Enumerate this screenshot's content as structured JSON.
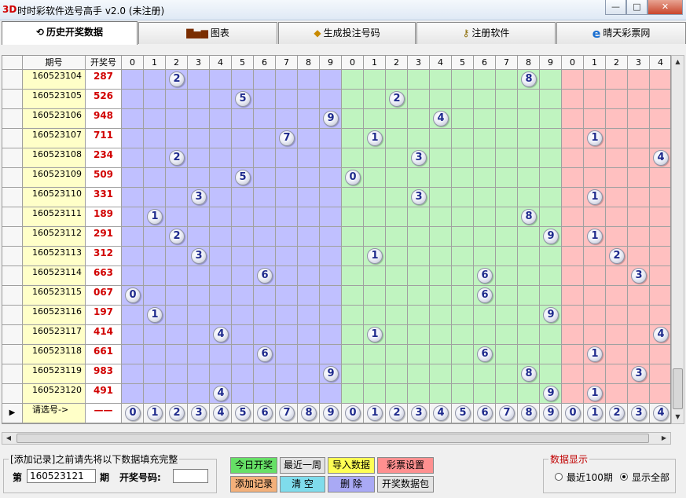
{
  "window": {
    "logo": "3D",
    "title": "时时彩软件选号高手 v2.0 (未注册)",
    "minimize": "—",
    "maximize": "□",
    "close": "✕"
  },
  "tabs": [
    {
      "label": "历史开奖数据",
      "icon": "history-icon",
      "active": true
    },
    {
      "label": "图表",
      "icon": "chart-icon",
      "active": false
    },
    {
      "label": "生成投注号码",
      "icon": "generate-icon",
      "active": false
    },
    {
      "label": "注册软件",
      "icon": "key-icon",
      "active": false
    },
    {
      "label": "晴天彩票网",
      "icon": "ie-browser-icon",
      "active": false
    }
  ],
  "grid": {
    "headers": {
      "period": "期号",
      "number": "开奖号"
    },
    "digit_headers": [
      "0",
      "1",
      "2",
      "3",
      "4",
      "5",
      "6",
      "7",
      "8",
      "9",
      "0",
      "1",
      "2",
      "3",
      "4",
      "5",
      "6",
      "7",
      "8",
      "9",
      "0",
      "1",
      "2",
      "3",
      "4"
    ],
    "zone_colors": [
      "#c0c0ff",
      "#c0f4c0",
      "#ffc0c0"
    ],
    "rows": [
      {
        "period": "160523104",
        "number": "287"
      },
      {
        "period": "160523105",
        "number": "526"
      },
      {
        "period": "160523106",
        "number": "948"
      },
      {
        "period": "160523107",
        "number": "711"
      },
      {
        "period": "160523108",
        "number": "234"
      },
      {
        "period": "160523109",
        "number": "509"
      },
      {
        "period": "160523110",
        "number": "331"
      },
      {
        "period": "160523111",
        "number": "189"
      },
      {
        "period": "160523112",
        "number": "291"
      },
      {
        "period": "160523113",
        "number": "312"
      },
      {
        "period": "160523114",
        "number": "663"
      },
      {
        "period": "160523115",
        "number": "067"
      },
      {
        "period": "160523116",
        "number": "197"
      },
      {
        "period": "160523117",
        "number": "414"
      },
      {
        "period": "160523118",
        "number": "661"
      },
      {
        "period": "160523119",
        "number": "983"
      },
      {
        "period": "160523120",
        "number": "491"
      }
    ],
    "select_row": {
      "label": "请选号->",
      "number": "——",
      "indicator": "▶"
    }
  },
  "bottom": {
    "add_group_legend": "[添加记录]之前请先将以下数据填充完整",
    "period_prefix": "第",
    "period_value": "160523121",
    "period_suffix": "期",
    "number_label": "开奖号码:",
    "number_value": "",
    "buttons": {
      "today": "今日开奖",
      "week": "最近一周",
      "import": "导入数据",
      "settings": "彩票设置",
      "add": "添加记录",
      "clear": "清 空",
      "delete": "删 除",
      "package": "开奖数据包"
    },
    "display_legend": "数据显示",
    "radio_recent": "最近100期",
    "radio_all": "显示全部",
    "selected": "显示全部"
  }
}
